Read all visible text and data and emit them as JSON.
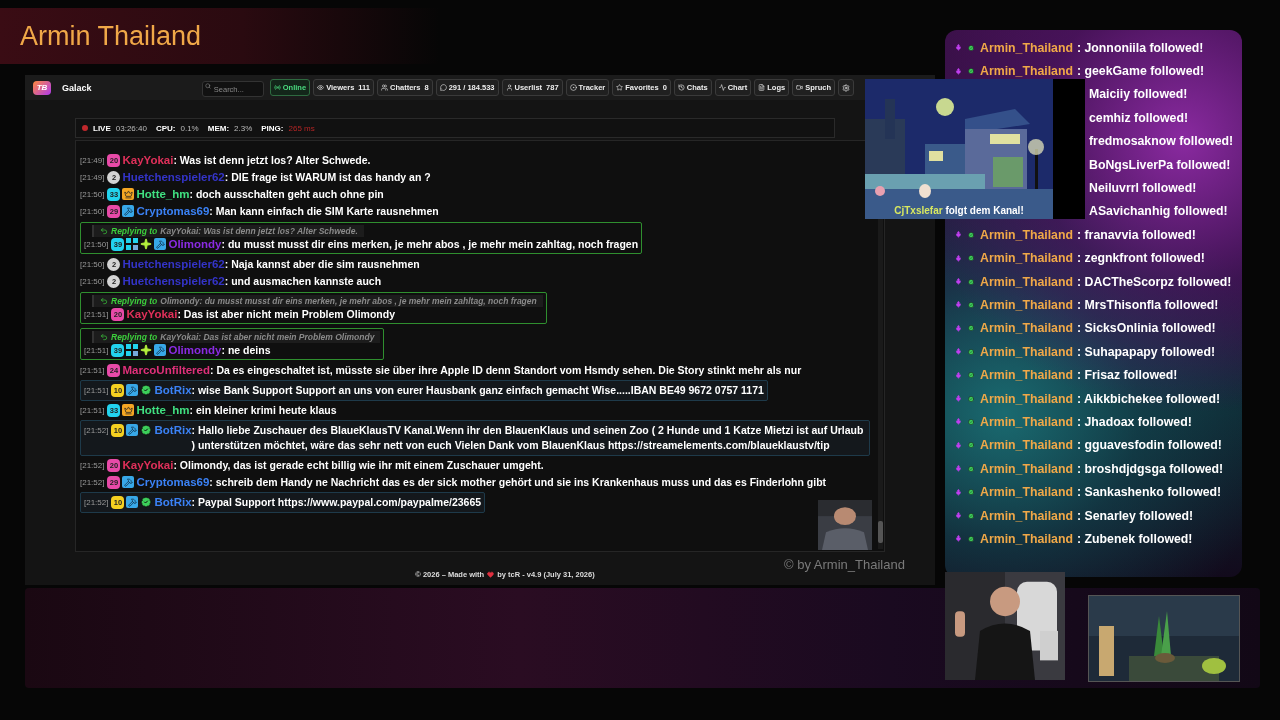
{
  "banner": {
    "title": "Armin Thailand"
  },
  "app": {
    "logo": "TB",
    "title": "Galack",
    "search": {
      "placeholder": "Search..."
    },
    "toolbar": [
      {
        "label": "Online",
        "on": true
      },
      {
        "label": "Viewers",
        "count": "111",
        "on": false
      },
      {
        "label": "Chatters",
        "count": "8",
        "on": false
      },
      {
        "label": "291 / 184.533",
        "on": false
      },
      {
        "label": "Userlist",
        "count": "787",
        "on": false
      },
      {
        "label": "Tracker",
        "on": false
      },
      {
        "label": "Favorites",
        "count": "0",
        "on": false
      },
      {
        "label": "Chats",
        "on": false
      },
      {
        "label": "Chart",
        "on": false
      },
      {
        "label": "Logs",
        "on": false
      },
      {
        "label": "Spruch",
        "on": false
      }
    ],
    "status": {
      "live": "LIVE",
      "uptime": "03:26:40",
      "stats": [
        {
          "label": "CPU:",
          "value": "0.1%",
          "alert": false
        },
        {
          "label": "MEM:",
          "value": "2.3%",
          "alert": false
        },
        {
          "label": "PING:",
          "value": "265 ms",
          "alert": true
        }
      ]
    },
    "chat": {
      "messages": [
        {
          "time": "[21:49]",
          "badges": [
            {
              "kind": "level",
              "text": "20",
              "color": "#e84aa8"
            }
          ],
          "user": "KayYokai",
          "color": "#e0305a",
          "text": ": Was ist denn jetzt los? Alter Schwede.",
          "bot": false
        },
        {
          "time": "[21:49]",
          "badges": [
            {
              "kind": "level",
              "text": "2",
              "color": "#d4d4d4"
            }
          ],
          "user": "Huetchenspieler62",
          "color": "#3434c8",
          "text": ": DIE frage ist WARUM ist das handy an ?",
          "bot": false
        },
        {
          "time": "[21:50]",
          "badges": [
            {
              "kind": "level",
              "text": "33",
              "color": "#22d3ee"
            },
            {
              "kind": "crown"
            }
          ],
          "user": "Hotte_hm",
          "color": "#40e080",
          "text": ": doch ausschalten geht auch ohne pin",
          "bot": false
        },
        {
          "time": "[21:50]",
          "badges": [
            {
              "kind": "level",
              "text": "29",
              "color": "#e84aa8"
            },
            {
              "kind": "hammer"
            }
          ],
          "user": "Cryptomas69",
          "color": "#3b82f6",
          "text": ": Man kann einfach die SIM Karte rausnehmen",
          "bot": false
        },
        {
          "time": "[21:50]",
          "badges": [
            {
              "kind": "level",
              "text": "39",
              "color": "#22d3ee"
            },
            {
              "kind": "tier"
            },
            {
              "kind": "sparkle"
            },
            {
              "kind": "hammer"
            }
          ],
          "user": "Olimondy",
          "color": "#8a2be2",
          "text": ": du musst musst dir eins merken, je mehr abos , je mehr mein zahltag, noch fragen",
          "bot": false,
          "reply": {
            "label": "Replying to",
            "quote": "KayYokai: Was ist denn jetzt los? Alter Schwede."
          }
        },
        {
          "time": "[21:50]",
          "badges": [
            {
              "kind": "level",
              "text": "2",
              "color": "#d4d4d4"
            }
          ],
          "user": "Huetchenspieler62",
          "color": "#3434c8",
          "text": ": Naja kannst aber die sim rausnehmen",
          "bot": false
        },
        {
          "time": "[21:50]",
          "badges": [
            {
              "kind": "level",
              "text": "2",
              "color": "#d4d4d4"
            }
          ],
          "user": "Huetchenspieler62",
          "color": "#3434c8",
          "text": ": und ausmachen kannste auch",
          "bot": false
        },
        {
          "time": "[21:51]",
          "badges": [
            {
              "kind": "level",
              "text": "20",
              "color": "#e84aa8"
            }
          ],
          "user": "KayYokai",
          "color": "#e0305a",
          "text": ": Das ist aber nicht mein Problem Olimondy",
          "bot": false,
          "reply": {
            "label": "Replying to",
            "quote": "Olimondy: du musst musst dir eins merken, je mehr abos , je mehr mein zahltag, noch fragen"
          }
        },
        {
          "time": "[21:51]",
          "badges": [
            {
              "kind": "level",
              "text": "39",
              "color": "#22d3ee"
            },
            {
              "kind": "tier"
            },
            {
              "kind": "sparkle"
            },
            {
              "kind": "hammer"
            }
          ],
          "user": "Olimondy",
          "color": "#8a2be2",
          "text": ": ne deins",
          "bot": false,
          "reply": {
            "label": "Replying to",
            "quote": "KayYokai: Das ist aber nicht mein Problem Olimondy"
          }
        },
        {
          "time": "[21:51]",
          "badges": [
            {
              "kind": "level",
              "text": "24",
              "color": "#e84aa8"
            }
          ],
          "user": "MarcoUnfiltered",
          "color": "#e0307a",
          "text": ": Da es eingeschaltet ist, müsste sie über ihre Apple ID denn Standort vom Hsmdy sehen. Die Story stinkt mehr als nur",
          "bot": false
        },
        {
          "time": "[21:51]",
          "badges": [
            {
              "kind": "level",
              "text": "10",
              "color": "#f5d020"
            },
            {
              "kind": "hammer"
            },
            {
              "kind": "verified"
            }
          ],
          "user": "BotRix",
          "color": "#3b82f6",
          "text": ": wise Bank Support Support an uns von eurer Hausbank ganz einfach gemacht Wise.....IBAN BE49 9672 0757 1171",
          "bot": true
        },
        {
          "time": "[21:51]",
          "badges": [
            {
              "kind": "level",
              "text": "33",
              "color": "#22d3ee"
            },
            {
              "kind": "crown"
            }
          ],
          "user": "Hotte_hm",
          "color": "#40e080",
          "text": ": ein kleiner krimi heute klaus",
          "bot": false
        },
        {
          "time": "[21:52]",
          "badges": [
            {
              "kind": "level",
              "text": "10",
              "color": "#f5d020"
            },
            {
              "kind": "hammer"
            },
            {
              "kind": "verified"
            }
          ],
          "user": "BotRix",
          "color": "#3b82f6",
          "text": ": Hallo liebe Zuschauer des BlaueKlausTV Kanal.Wenn ihr den BlauenKlaus und seinen Zoo ( 2 Hunde und 1 Katze Mietzi ist auf Urlaub ) unterstützen möchtet, wäre das sehr nett von euch Vielen Dank vom BlauenKlaus https://streamelements.com/blaueklaustv/tip",
          "bot": true
        },
        {
          "time": "[21:52]",
          "badges": [
            {
              "kind": "level",
              "text": "20",
              "color": "#e84aa8"
            }
          ],
          "user": "KayYokai",
          "color": "#e0305a",
          "text": ": Olimondy, das ist gerade echt billig wie ihr mit einem Zuschauer umgeht.",
          "bot": false
        },
        {
          "time": "[21:52]",
          "badges": [
            {
              "kind": "level",
              "text": "29",
              "color": "#e84aa8"
            },
            {
              "kind": "hammer"
            }
          ],
          "user": "Cryptomas69",
          "color": "#3b82f6",
          "text": ": schreib dem Handy ne Nachricht das es der sick mother gehört und sie ins Krankenhaus muss und das es Finderlohn gibt",
          "bot": false
        },
        {
          "time": "[21:52]",
          "badges": [
            {
              "kind": "level",
              "text": "10",
              "color": "#f5d020"
            },
            {
              "kind": "hammer"
            },
            {
              "kind": "verified"
            }
          ],
          "user": "BotRix",
          "color": "#3b82f6",
          "text": ": Paypal Support https://www.paypal.com/paypalme/23665",
          "bot": true
        }
      ]
    },
    "footer": {
      "before": "© 2026 – Made with",
      "after": "by tcR - v4.9 (July 31, 2026)"
    }
  },
  "watermark": "© by Armin_Thailand",
  "alert": {
    "user": "CjTxslefar",
    "text": "folgt dem Kanal!"
  },
  "follows": [
    {
      "channel": "Armin_Thailand",
      "text": ": Jonnoniila followed!"
    },
    {
      "channel": "Armin_Thailand",
      "text": ": geekGame followed!"
    },
    {
      "text": "Maiciiy followed!"
    },
    {
      "text": "cemhiz followed!"
    },
    {
      "text": "fredmosaknow followed!"
    },
    {
      "text": "BoNgsLiverPa followed!"
    },
    {
      "text": "Neiluvrrl followed!"
    },
    {
      "text": "ASavichanhig followed!"
    },
    {
      "channel": "Armin_Thailand",
      "text": ": franavvia followed!"
    },
    {
      "channel": "Armin_Thailand",
      "text": ": zegnkfront followed!"
    },
    {
      "channel": "Armin_Thailand",
      "text": ": DACTheScorpz followed!"
    },
    {
      "channel": "Armin_Thailand",
      "text": ": MrsThisonfla followed!"
    },
    {
      "channel": "Armin_Thailand",
      "text": ": SicksOnlinia followed!"
    },
    {
      "channel": "Armin_Thailand",
      "text": ": Suhapapapy followed!"
    },
    {
      "channel": "Armin_Thailand",
      "text": ": Frisaz followed!"
    },
    {
      "channel": "Armin_Thailand",
      "text": ": Aikkbichekee followed!"
    },
    {
      "channel": "Armin_Thailand",
      "text": ": Jhadoax followed!"
    },
    {
      "channel": "Armin_Thailand",
      "text": ": gguavesfodin followed!"
    },
    {
      "channel": "Armin_Thailand",
      "text": ": broshdjdgsga followed!"
    },
    {
      "channel": "Armin_Thailand",
      "text": ": Sankashenko followed!"
    },
    {
      "channel": "Armin_Thailand",
      "text": ": Senarley followed!"
    },
    {
      "channel": "Armin_Thailand",
      "text": ": Zubenek followed!"
    }
  ]
}
